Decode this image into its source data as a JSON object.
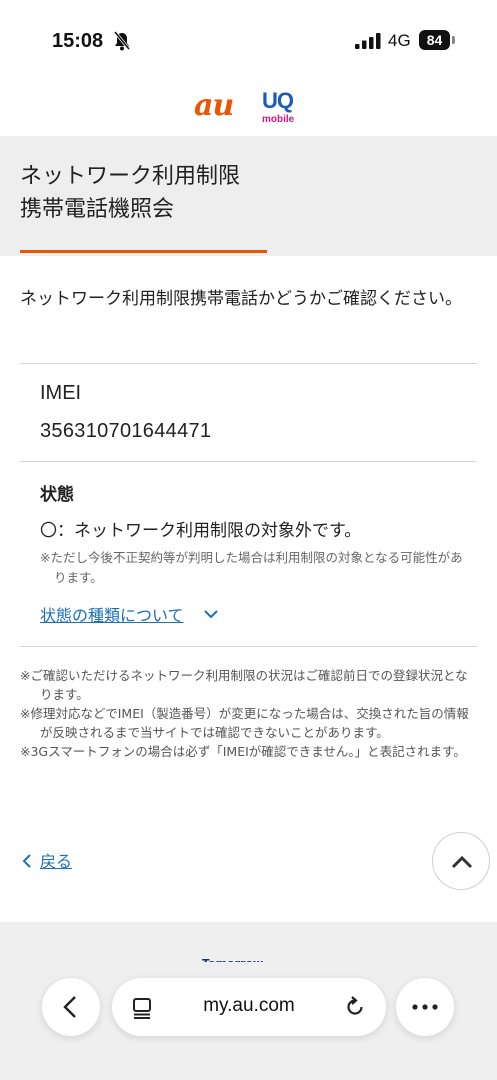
{
  "status_bar": {
    "time": "15:08",
    "network": "4G",
    "battery": "84"
  },
  "header": {
    "au_logo": "au",
    "uq_logo": "UQ",
    "uq_sub": "mobile"
  },
  "page": {
    "title_line1": "ネットワーク利用制限",
    "title_line2": "携帯電話機照会",
    "intro": "ネットワーク利用制限携帯電話かどうかご確認ください。"
  },
  "result": {
    "imei_label": "IMEI",
    "imei_value": "356310701644471",
    "state_label": "状態",
    "state_value": "〇：ネットワーク利用制限の対象外です。",
    "state_note": "※ただし今後不正契約等が判明した場合は利用制限の対象となる可能性があります。",
    "state_link": "状態の種類について"
  },
  "notes": [
    "※ご確認いただけるネットワーク利用制限の状況はご確認前日での登録状況となります。",
    "※修理対応などでIMEI（製造番号）が変更になった場合は、交換された旨の情報が反映されるまで当サイトでは確認できないことがあります。",
    "※3Gスマートフォンの場合は必ず「IMEIが確認できません。」と表記されます。"
  ],
  "navigation": {
    "back_label": "戻る"
  },
  "footer": {
    "tagline": "Tomorrow, Together"
  },
  "browser": {
    "url": "my.au.com"
  },
  "colors": {
    "brand_orange": "#eb5505",
    "link_blue": "#1a6fc0",
    "uq_blue": "#1b5db6",
    "uq_pink": "#d8147d"
  }
}
